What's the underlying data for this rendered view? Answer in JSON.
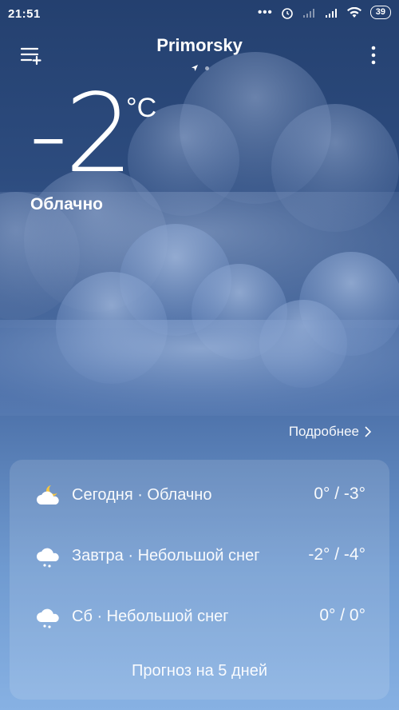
{
  "status_bar": {
    "time": "21:51",
    "battery": "39"
  },
  "header": {
    "city": "Primorsky"
  },
  "current": {
    "temperature": "-2",
    "unit": "°C",
    "condition": "Облачно"
  },
  "details_link": "Подробнее",
  "forecast": [
    {
      "day": "Сегодня · Облачно",
      "range": "0° / -3°",
      "icon": "partly-cloudy-night-icon"
    },
    {
      "day": "Завтра · Небольшой снег",
      "range": "-2° / -4°",
      "icon": "light-snow-icon"
    },
    {
      "day": "Сб · Небольшой снег",
      "range": "0° / 0°",
      "icon": "light-snow-icon"
    }
  ],
  "forecast_button": "Прогноз на 5 дней"
}
